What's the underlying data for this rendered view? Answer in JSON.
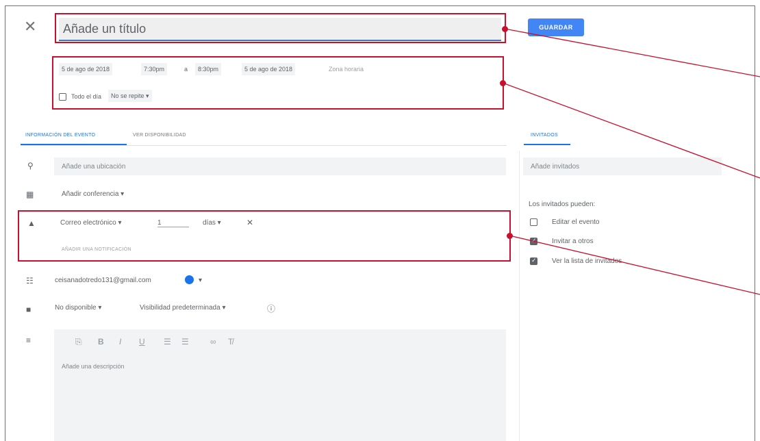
{
  "header": {
    "close_icon": "close-icon",
    "title_placeholder": "Añade un título",
    "save_label": "GUARDAR"
  },
  "datetime": {
    "start_date": "5 de ago de 2018",
    "start_time": "7:30pm",
    "to": "a",
    "end_time": "8:30pm",
    "end_date": "5 de ago de 2018",
    "timezone": "Zona horaria",
    "all_day_label": "Todo el día",
    "repeat": "No se repite"
  },
  "tabs": {
    "event_details": "INFORMACIÓN DEL EVENTO",
    "find_time": "VER DISPONIBILIDAD",
    "guests": "INVITADOS"
  },
  "details": {
    "location_placeholder": "Añade una ubicación",
    "conference": "Añadir conferencia",
    "notification_type": "Correo electrónico",
    "notification_value": "1",
    "notification_unit": "días",
    "add_notification": "AÑADIR UNA NOTIFICACIÓN",
    "calendar_owner": "ceisanadotredo131@gmail.com",
    "availability": "No disponible",
    "visibility": "Visibilidad predeterminada",
    "description_placeholder": "Añade una descripción"
  },
  "guests": {
    "add_placeholder": "Añade invitados",
    "permissions_title": "Los invitados pueden:",
    "permissions": [
      {
        "label": "Editar el evento",
        "checked": false
      },
      {
        "label": "Invitar a otros",
        "checked": true
      },
      {
        "label": "Ver la lista de invitados",
        "checked": true
      }
    ]
  },
  "colors": {
    "accent": "#4285f4",
    "highlight": "#c8102e",
    "calendar_color": "#1a73e8"
  }
}
